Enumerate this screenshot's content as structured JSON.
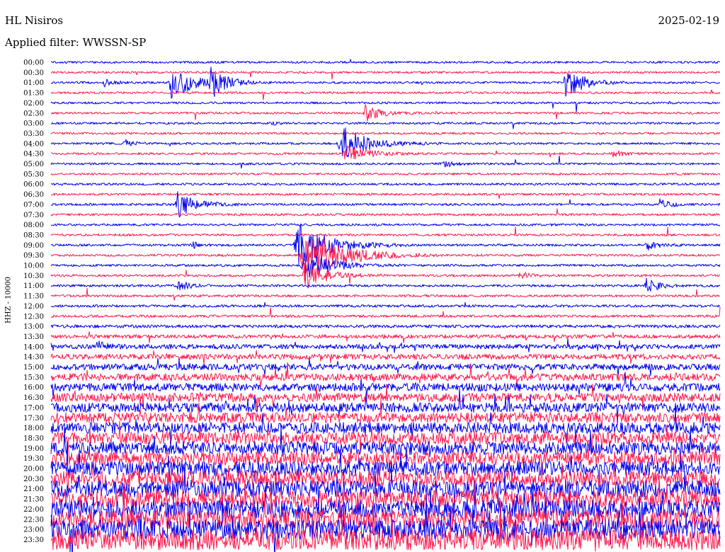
{
  "header": {
    "station": "HL Nisiros",
    "date": "2025-02-19",
    "filter_label": "Applied filter: WWSSN-SP"
  },
  "channel_label": "HHZ - 10000",
  "colors": {
    "blue": "#0000ee",
    "red": "#ff1a4f",
    "background": "#ffffff"
  },
  "chart_data": {
    "type": "line",
    "title": "",
    "xlabel": "",
    "ylabel": "HHZ - 10000",
    "row_labels": [
      "00:00",
      "00:30",
      "01:00",
      "01:30",
      "02:00",
      "02:30",
      "03:00",
      "03:30",
      "04:00",
      "04:30",
      "05:00",
      "05:30",
      "06:00",
      "06:30",
      "07:00",
      "07:30",
      "08:00",
      "08:30",
      "09:00",
      "09:30",
      "10:00",
      "10:30",
      "11:00",
      "11:30",
      "12:00",
      "12:30",
      "13:00",
      "13:30",
      "14:00",
      "14:30",
      "15:00",
      "15:30",
      "16:00",
      "16:30",
      "17:00",
      "17:30",
      "18:00",
      "18:30",
      "19:00",
      "19:30",
      "20:00",
      "20:30",
      "21:00",
      "21:30",
      "22:00",
      "22:30",
      "23:00",
      "23:30"
    ],
    "row_colors": [
      "blue",
      "red"
    ],
    "noise_level": [
      1.5,
      1.5,
      1.5,
      1.5,
      1.5,
      1.5,
      1.5,
      1.5,
      1.5,
      1.5,
      1.5,
      1.5,
      1.6,
      1.6,
      1.6,
      1.6,
      1.6,
      1.6,
      1.6,
      1.6,
      1.6,
      1.6,
      1.7,
      1.7,
      1.8,
      1.8,
      2.2,
      2.6,
      3.2,
      3.8,
      4.4,
      5,
      5.6,
      6.2,
      6.8,
      7.4,
      8,
      8.6,
      9.2,
      9.8,
      10.4,
      11,
      11.6,
      12.2,
      12.8,
      13.4,
      14,
      14.6
    ],
    "events": [
      {
        "row": 2,
        "position": 0.18,
        "amplitude": 26,
        "duration": 0.04
      },
      {
        "row": 2,
        "position": 0.24,
        "amplitude": 20,
        "duration": 0.03
      },
      {
        "row": 2,
        "position": 0.77,
        "amplitude": 22,
        "duration": 0.035
      },
      {
        "row": 2,
        "position": 0.08,
        "amplitude": 5,
        "duration": 0.02
      },
      {
        "row": 5,
        "position": 0.47,
        "amplitude": 12,
        "duration": 0.03
      },
      {
        "row": 6,
        "position": 0.33,
        "amplitude": 3,
        "duration": 0.01
      },
      {
        "row": 8,
        "position": 0.435,
        "amplitude": 24,
        "duration": 0.05
      },
      {
        "row": 8,
        "position": 0.11,
        "amplitude": 5,
        "duration": 0.02
      },
      {
        "row": 9,
        "position": 0.44,
        "amplitude": 14,
        "duration": 0.04
      },
      {
        "row": 9,
        "position": 0.84,
        "amplitude": 5,
        "duration": 0.02
      },
      {
        "row": 10,
        "position": 0.585,
        "amplitude": 6,
        "duration": 0.02
      },
      {
        "row": 14,
        "position": 0.19,
        "amplitude": 20,
        "duration": 0.035
      },
      {
        "row": 14,
        "position": 0.91,
        "amplitude": 8,
        "duration": 0.02
      },
      {
        "row": 18,
        "position": 0.37,
        "amplitude": 32,
        "duration": 0.06
      },
      {
        "row": 18,
        "position": 0.21,
        "amplitude": 5,
        "duration": 0.015
      },
      {
        "row": 18,
        "position": 0.89,
        "amplitude": 8,
        "duration": 0.02
      },
      {
        "row": 19,
        "position": 0.38,
        "amplitude": 38,
        "duration": 0.07
      },
      {
        "row": 20,
        "position": 0.38,
        "amplitude": 20,
        "duration": 0.05
      },
      {
        "row": 21,
        "position": 0.38,
        "amplitude": 22,
        "duration": 0.04
      },
      {
        "row": 21,
        "position": 0.7,
        "amplitude": 6,
        "duration": 0.02
      },
      {
        "row": 22,
        "position": 0.19,
        "amplitude": 8,
        "duration": 0.02
      },
      {
        "row": 22,
        "position": 0.89,
        "amplitude": 10,
        "duration": 0.025
      },
      {
        "row": 28,
        "position": 0.07,
        "amplitude": 6,
        "duration": 0.02
      }
    ]
  }
}
